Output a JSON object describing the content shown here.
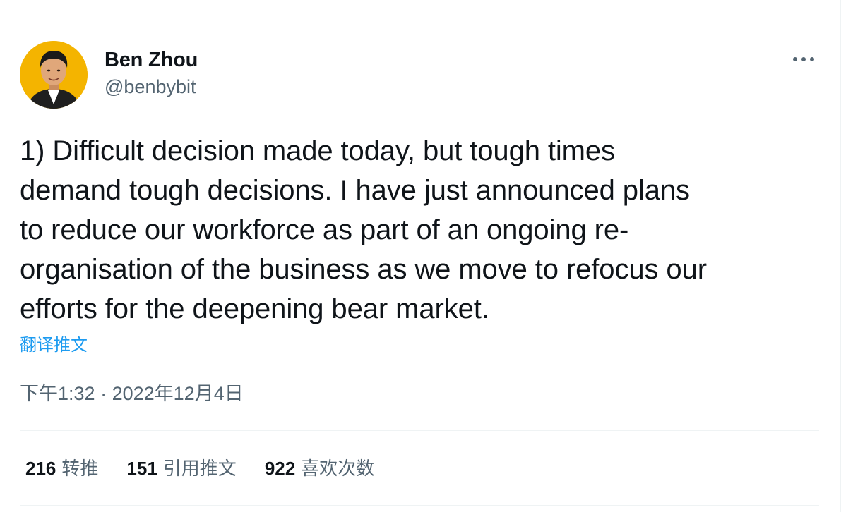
{
  "tweet": {
    "author": {
      "display_name": "Ben Zhou",
      "handle": "@benbybit"
    },
    "more_icon": "more-horizontal-icon",
    "text_lines": [
      "1) Difficult decision made today, but tough times",
      "demand tough decisions. I have just announced plans",
      "to reduce our workforce as part of an ongoing re-",
      "organisation of the business as we move to refocus our",
      "efforts for the deepening bear market."
    ],
    "translate_label": "翻译推文",
    "timestamp": {
      "time": "下午1:32",
      "separator": "·",
      "date": "2022年12月4日"
    },
    "stats": {
      "retweets": {
        "count": "216",
        "label": "转推"
      },
      "quotes": {
        "count": "151",
        "label": "引用推文"
      },
      "likes": {
        "count": "922",
        "label": "喜欢次数"
      }
    }
  },
  "colors": {
    "text_primary": "#0f1419",
    "text_secondary": "#536471",
    "link": "#1d9bf0",
    "divider": "#eff3f4",
    "avatar_background": "#f4b400"
  }
}
